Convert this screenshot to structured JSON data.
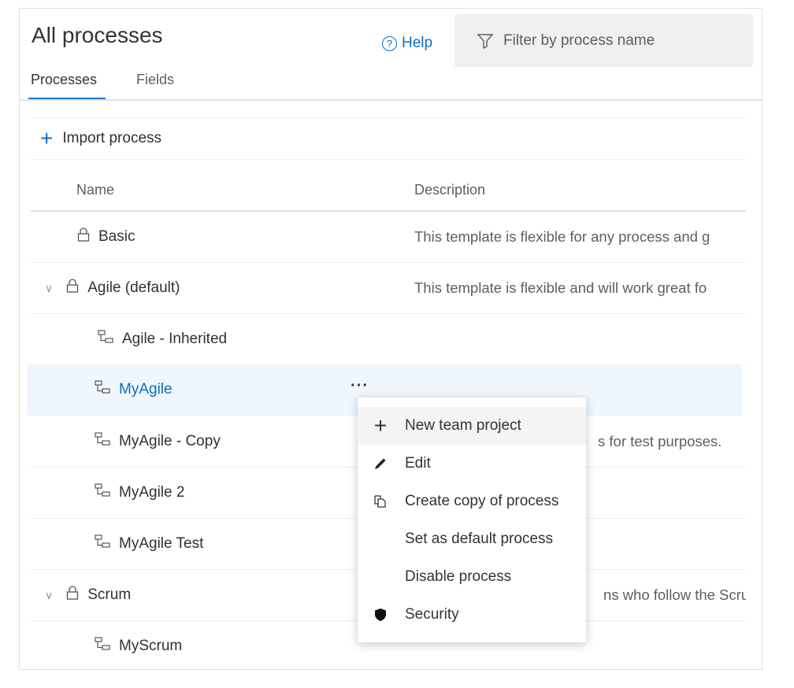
{
  "header": {
    "title": "All processes",
    "help_label": "Help",
    "filter_placeholder": "Filter by process name"
  },
  "tabs": [
    {
      "label": "Processes",
      "active": true
    },
    {
      "label": "Fields",
      "active": false
    }
  ],
  "toolbar": {
    "import_label": "Import process"
  },
  "columns": {
    "name": "Name",
    "description": "Description"
  },
  "rows": [
    {
      "name": "Basic",
      "icon": "lock-icon",
      "description": "This template is flexible for any process and g"
    },
    {
      "name": "Agile (default)",
      "icon": "lock-icon",
      "expanded": true,
      "description": "This template is flexible and will work great fo"
    },
    {
      "name": "Agile - Inherited",
      "icon": "inherited-process-icon",
      "description": ""
    },
    {
      "name": "MyAgile",
      "icon": "inherited-process-icon",
      "description": "",
      "selected": true
    },
    {
      "name": "MyAgile - Copy",
      "icon": "inherited-process-icon",
      "description": "s for test purposes."
    },
    {
      "name": "MyAgile 2",
      "icon": "inherited-process-icon",
      "description": ""
    },
    {
      "name": "MyAgile Test",
      "icon": "inherited-process-icon",
      "description": ""
    },
    {
      "name": "Scrum",
      "icon": "lock-icon",
      "expanded": true,
      "description": "ns who follow the Scru"
    },
    {
      "name": "MyScrum",
      "icon": "inherited-process-icon",
      "description": ""
    }
  ],
  "context_menu": [
    {
      "label": "New team project",
      "icon": "plus-icon"
    },
    {
      "label": "Edit",
      "icon": "pencil-icon"
    },
    {
      "label": "Create copy of process",
      "icon": "copy-icon"
    },
    {
      "label": "Set as default process",
      "icon": ""
    },
    {
      "label": "Disable process",
      "icon": ""
    },
    {
      "label": "Security",
      "icon": "shield-icon"
    }
  ],
  "colors": {
    "accent": "#0078d4",
    "link": "#106ebe",
    "selected_row": "#eff6fc"
  }
}
